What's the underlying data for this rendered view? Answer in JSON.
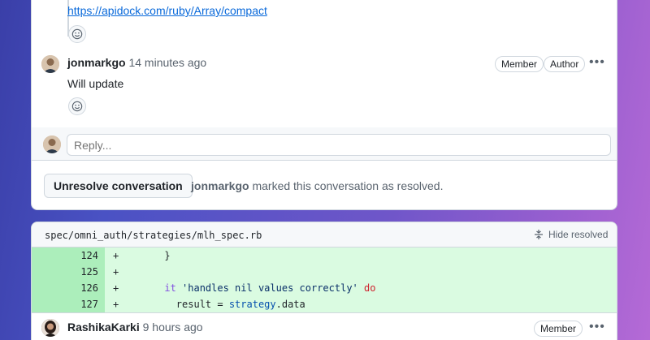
{
  "thread": {
    "link_text": "https://apidock.com/ruby/Array/compact",
    "comment": {
      "author": "jonmarkgo",
      "time": "14 minutes ago",
      "badges": [
        "Member",
        "Author"
      ],
      "body": "Will update"
    },
    "reply_placeholder": "Reply...",
    "unresolve_label": "Unresolve conversation",
    "resolved_by": "jonmarkgo",
    "resolved_text": "marked this conversation as resolved."
  },
  "file": {
    "path": "spec/omni_auth/strategies/mlh_spec.rb",
    "hide_resolved": "Hide resolved",
    "lines": [
      {
        "num": "124",
        "sign": "+",
        "code": "      }"
      },
      {
        "num": "125",
        "sign": "+",
        "code": ""
      },
      {
        "num": "126",
        "sign": "+",
        "kw_code": {
          "pre": "      ",
          "kw1": "it",
          "str": " 'handles nil values correctly' ",
          "kw2": "do"
        }
      },
      {
        "num": "127",
        "sign": "+",
        "assign_code": {
          "pre": "        result = ",
          "obj": "strategy",
          "dot": ".",
          "prop": "data"
        }
      }
    ]
  },
  "next_comment": {
    "author": "RashikaKarki",
    "time": "9 hours ago",
    "badge": "Member"
  },
  "colors": {
    "link": "#0969da",
    "diff_add_bg": "#dafbe1",
    "diff_num_bg": "#aceebb",
    "border": "#d0d7de"
  }
}
